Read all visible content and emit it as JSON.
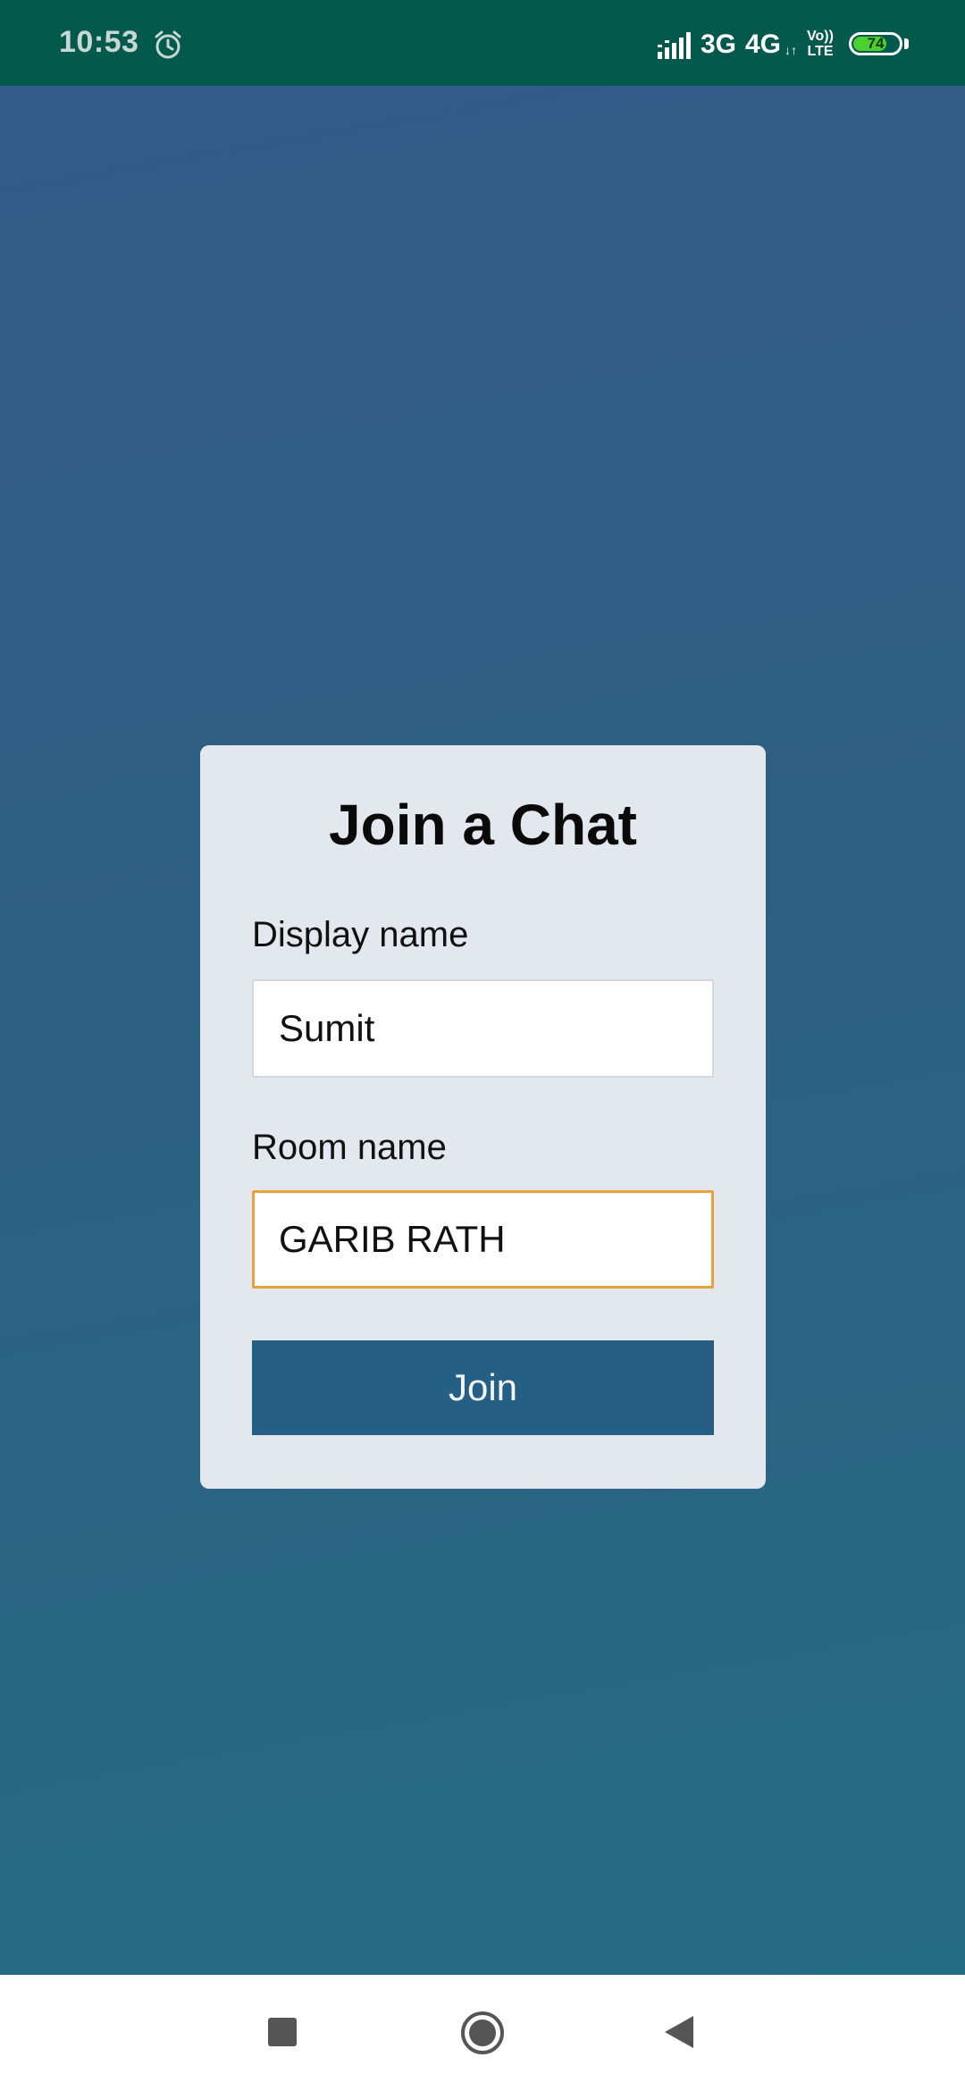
{
  "status_bar": {
    "time": "10:53",
    "network_1": "3G",
    "network_2": "4G",
    "data_arrows": "↓↑",
    "volte_top": "Vo))",
    "volte_bottom": "LTE",
    "battery_level": "74",
    "battery_fraction": 0.74,
    "icons": [
      "alarm-icon",
      "signal-icon"
    ]
  },
  "card": {
    "title": "Join a Chat",
    "display_name": {
      "label": "Display name",
      "value": "Sumit"
    },
    "room_name": {
      "label": "Room name",
      "value": "GARIB RATH"
    },
    "join_label": "Join"
  },
  "nav_bar": {
    "icons": [
      "recents-icon",
      "home-icon",
      "back-icon"
    ]
  },
  "colors": {
    "status_bar": "#02594c",
    "background_top": "#345a87",
    "background_bottom": "#256b82",
    "card": "#e3e8ee",
    "button": "#265f84",
    "focus_border": "#e9a23b",
    "battery": "#4cd02f"
  }
}
